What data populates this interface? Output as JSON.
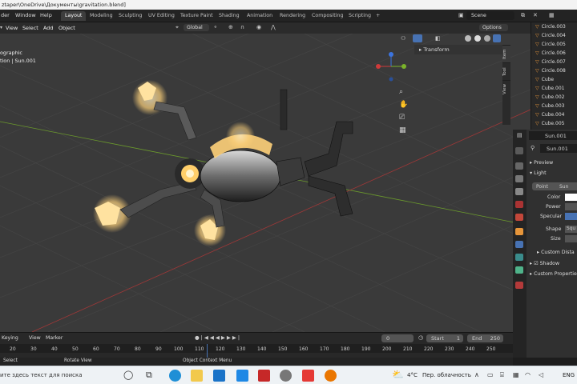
{
  "window": {
    "title": "ztaper\\OneDrive\\Документы\\gravitation.blend]"
  },
  "menu": [
    "der",
    "Window",
    "Help"
  ],
  "workspaces": [
    "Layout",
    "Modeling",
    "Sculpting",
    "UV Editing",
    "Texture Paint",
    "Shading",
    "Animation",
    "Rendering",
    "Compositing",
    "Scripting",
    "+"
  ],
  "scene": "Scene",
  "viewport_header": {
    "view": "View",
    "select": "Select",
    "add": "Add",
    "object": "Object",
    "orientation": "Global",
    "options": "Options"
  },
  "viewport": {
    "overlay_line1": "ographic",
    "overlay_line2": "tion | Sun.001"
  },
  "npanel": {
    "section": "Transform",
    "tabs": [
      "Item",
      "Tool",
      "View"
    ]
  },
  "outliner": {
    "items": [
      "Circle.003",
      "Circle.004",
      "Circle.005",
      "Circle.006",
      "Circle.007",
      "Circle.008",
      "Cube",
      "Cube.001",
      "Cube.002",
      "Cube.003",
      "Cube.004",
      "Cube.005"
    ]
  },
  "properties": {
    "object_name": "Sun.001",
    "data_name": "Sun.001",
    "preview": "Preview",
    "light": "Light",
    "light_types": [
      "Point",
      "Sun"
    ],
    "color_label": "Color",
    "power_label": "Power",
    "specular_label": "Specular",
    "shape_label": "Shape",
    "shape_value": "Squ",
    "size_label": "Size",
    "custom_distance": "Custom Dista",
    "shadow": "Shadow",
    "custom_properties": "Custom Propertie"
  },
  "timeline": {
    "keying": "Keying",
    "view": "View",
    "marker": "Marker",
    "current_frame": "0",
    "start_label": "Start",
    "start": "1",
    "end_label": "End",
    "end": "250",
    "ruler": [
      "20",
      "30",
      "40",
      "50",
      "60",
      "70",
      "80",
      "90",
      "100",
      "110",
      "120",
      "130",
      "140",
      "150",
      "160",
      "170",
      "180",
      "190",
      "200",
      "210",
      "220",
      "230",
      "240",
      "250"
    ]
  },
  "statusbar": {
    "select": "Select",
    "rotate": "Rotate View",
    "context": "Object Context Menu"
  },
  "taskbar": {
    "search": "ите здесь текст для поиска",
    "temperature": "4°C",
    "weather": "Пер. облачность",
    "lang": "ENG"
  },
  "colors": {
    "accent": "#4772b3",
    "active_tab": "#3d3d3d",
    "light_glow": "#ffd27a",
    "orange_icon": "#e6953a"
  }
}
